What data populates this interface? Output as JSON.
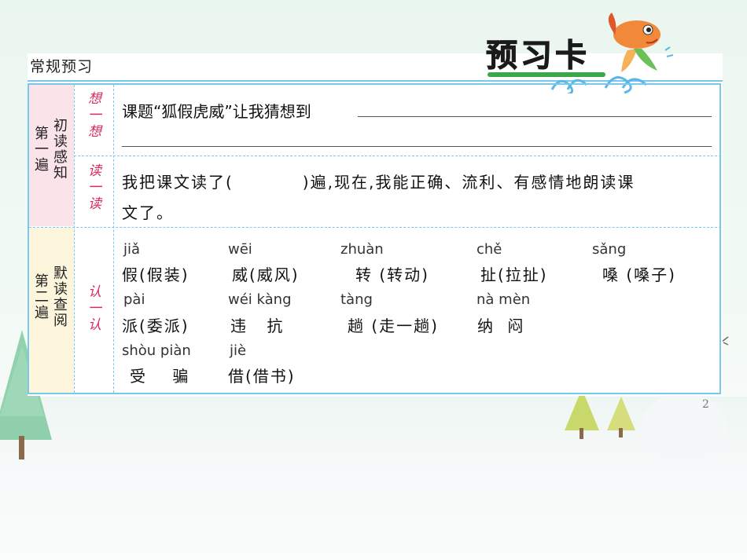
{
  "header": {
    "label": "常规预习",
    "logo_title": "预习卡",
    "page_number": "2"
  },
  "sections": {
    "first": {
      "pass": "第一遍",
      "title": "初读感知",
      "think": {
        "tag": "想一想",
        "prompt": "课题“狐假虎威”让我猜想到"
      },
      "read": {
        "tag": "读一读",
        "line1": "我把课文读了(　　　　)遍,现在,我能正确、流利、有感情地朗读课",
        "line2": "文了。"
      }
    },
    "second": {
      "pass": "第二遍",
      "title": "默读查阅",
      "recognize": {
        "tag": "认一认",
        "entries": [
          {
            "pinyin": "jiǎ",
            "chars": "假(假装)"
          },
          {
            "pinyin": "wēi",
            "chars": "威(威风)"
          },
          {
            "pinyin": "zhuàn",
            "chars": "转 (转动)"
          },
          {
            "pinyin": "chě",
            "chars": "扯(拉扯)"
          },
          {
            "pinyin": "sǎng",
            "chars": "嗓 (嗓子)"
          },
          {
            "pinyin": "pài",
            "chars": "派(委派)"
          },
          {
            "pinyin": "wéi kàng",
            "chars": "违 抗"
          },
          {
            "pinyin": "tàng",
            "chars": "趟 (走一趟)"
          },
          {
            "pinyin": "nà mèn",
            "chars": "纳 闷"
          },
          {
            "pinyin": "shòu piàn",
            "chars": "受 骗"
          },
          {
            "pinyin": "jiè",
            "chars": "借(借书)"
          }
        ]
      }
    }
  },
  "colors": {
    "border": "#79c9ef",
    "section1_bg": "#fbe3ea",
    "section2_bg": "#fdf6dc",
    "tag_red": "#d62c5c"
  }
}
